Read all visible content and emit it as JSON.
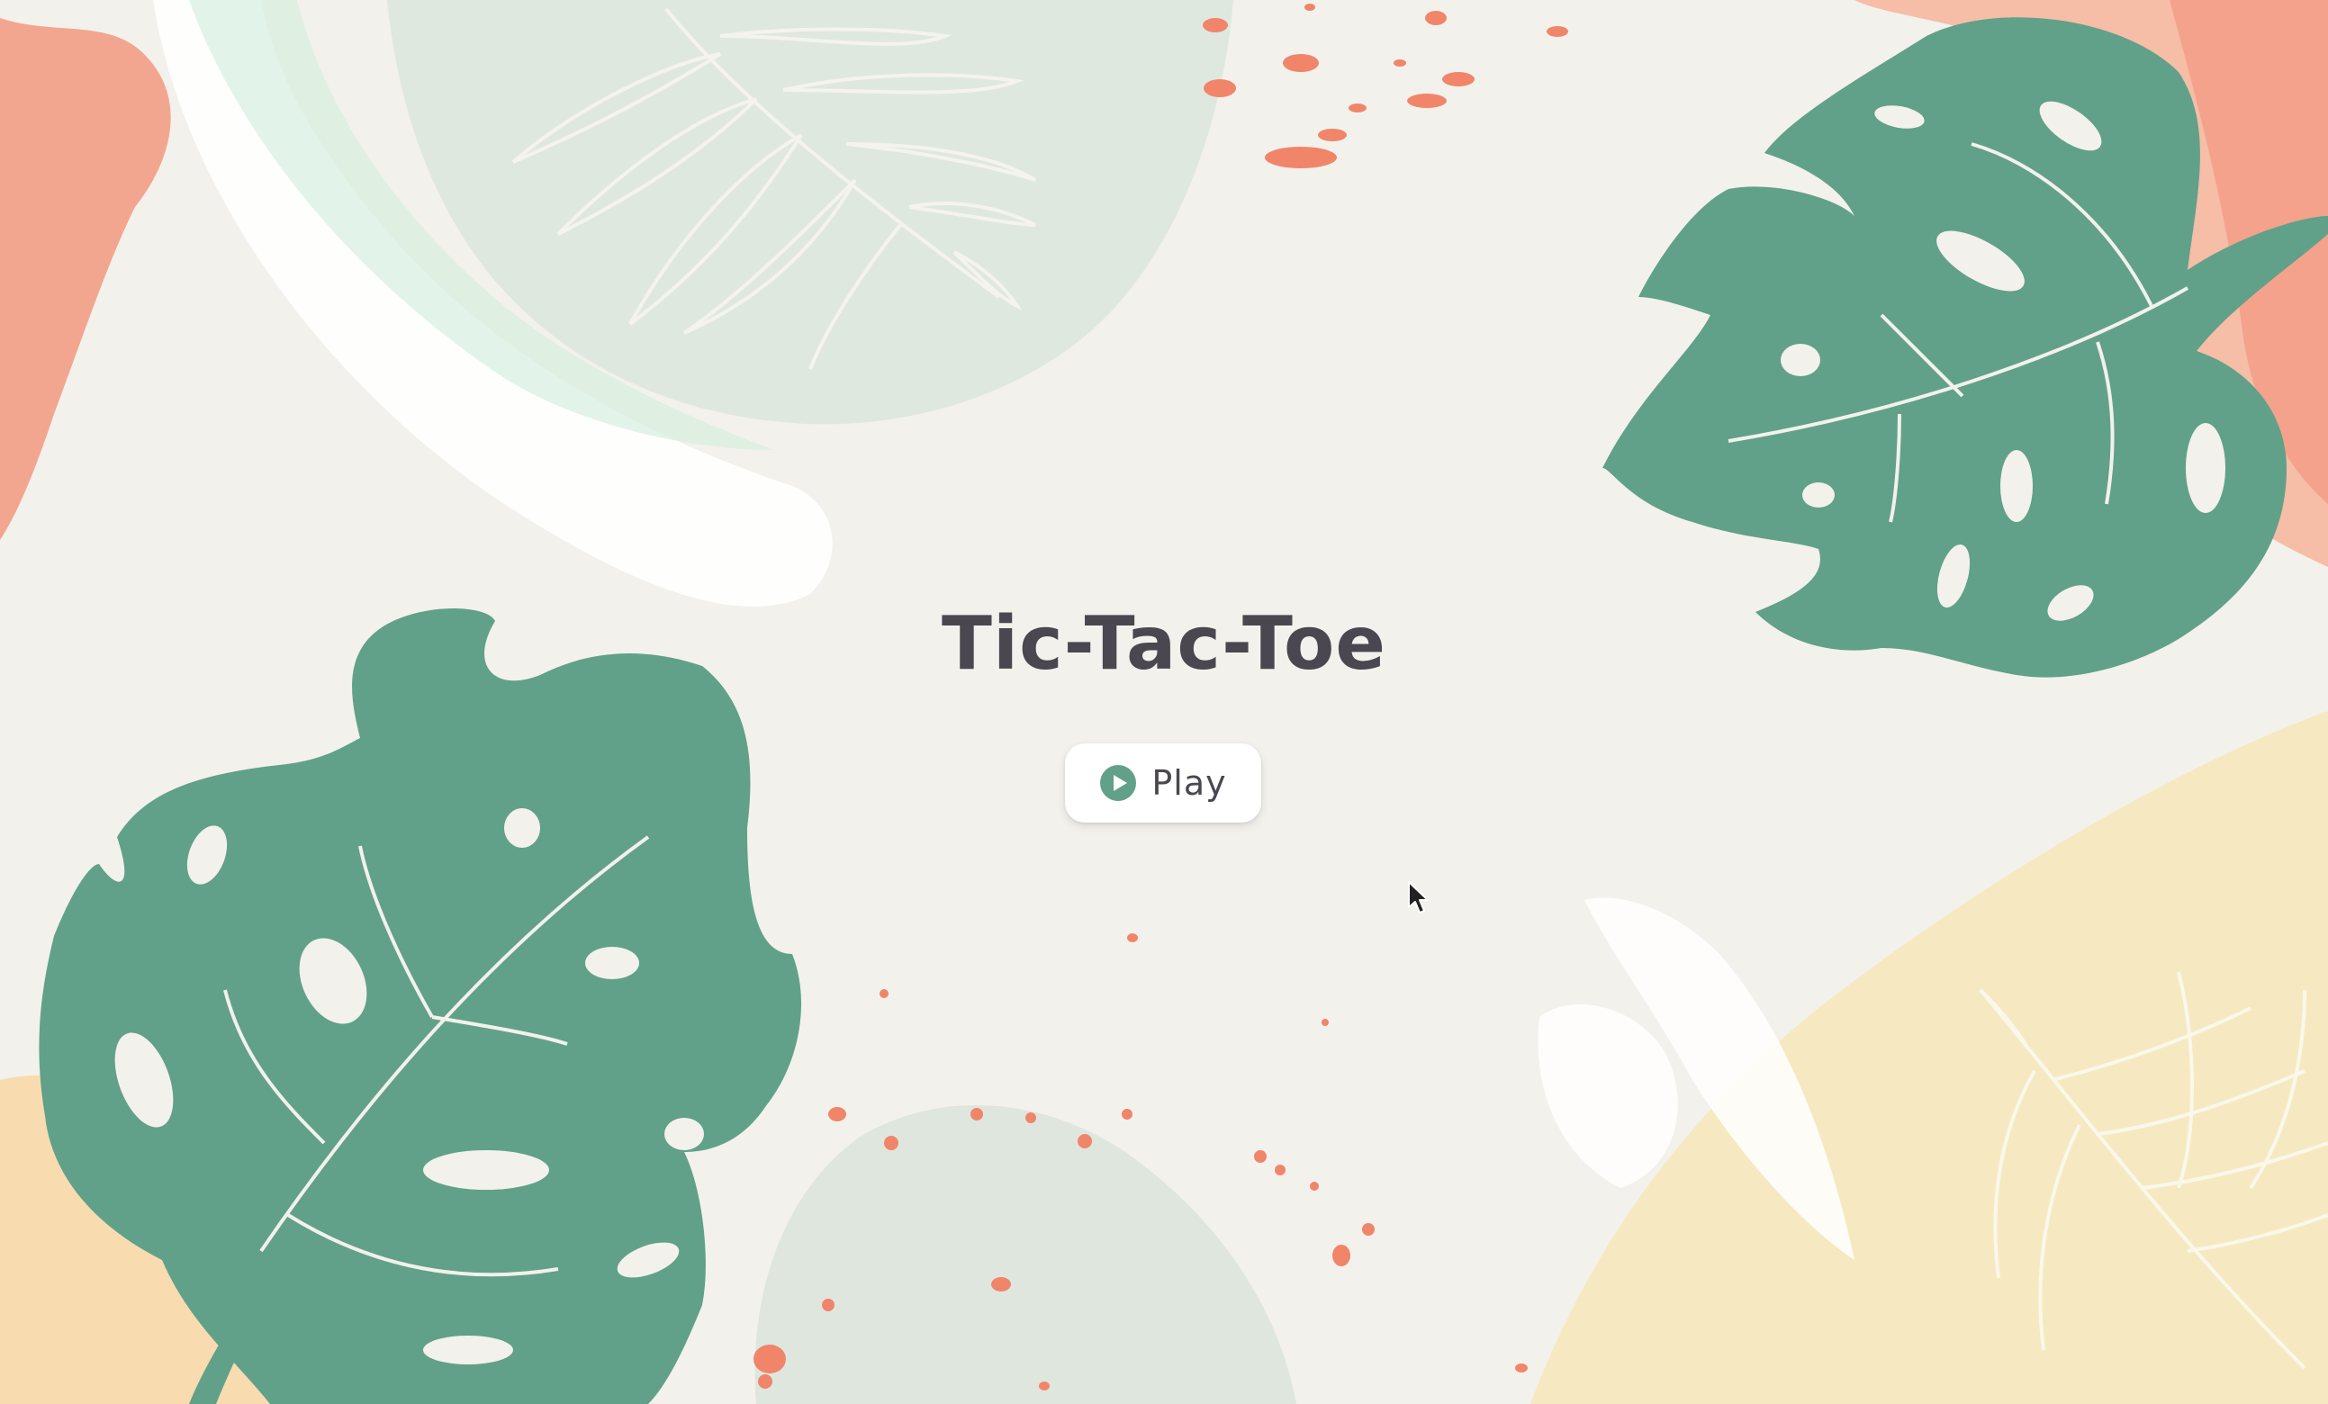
{
  "app": {
    "title": "Tic-Tac-Toe"
  },
  "menu": {
    "play_label": "Play",
    "play_icon": "play-circle-icon"
  },
  "theme": {
    "background": "#f3f1ec",
    "leaf_green": "#61a189",
    "coral": "#f2a18a",
    "mint": "#dcebe1",
    "sand": "#f6e7b8",
    "text": "#4a4750"
  },
  "decorations": {
    "leaf_icon": "monstera-leaf-icon",
    "fern_icon": "fern-outline-icon",
    "pointer_icon": "mouse-pointer-icon"
  }
}
